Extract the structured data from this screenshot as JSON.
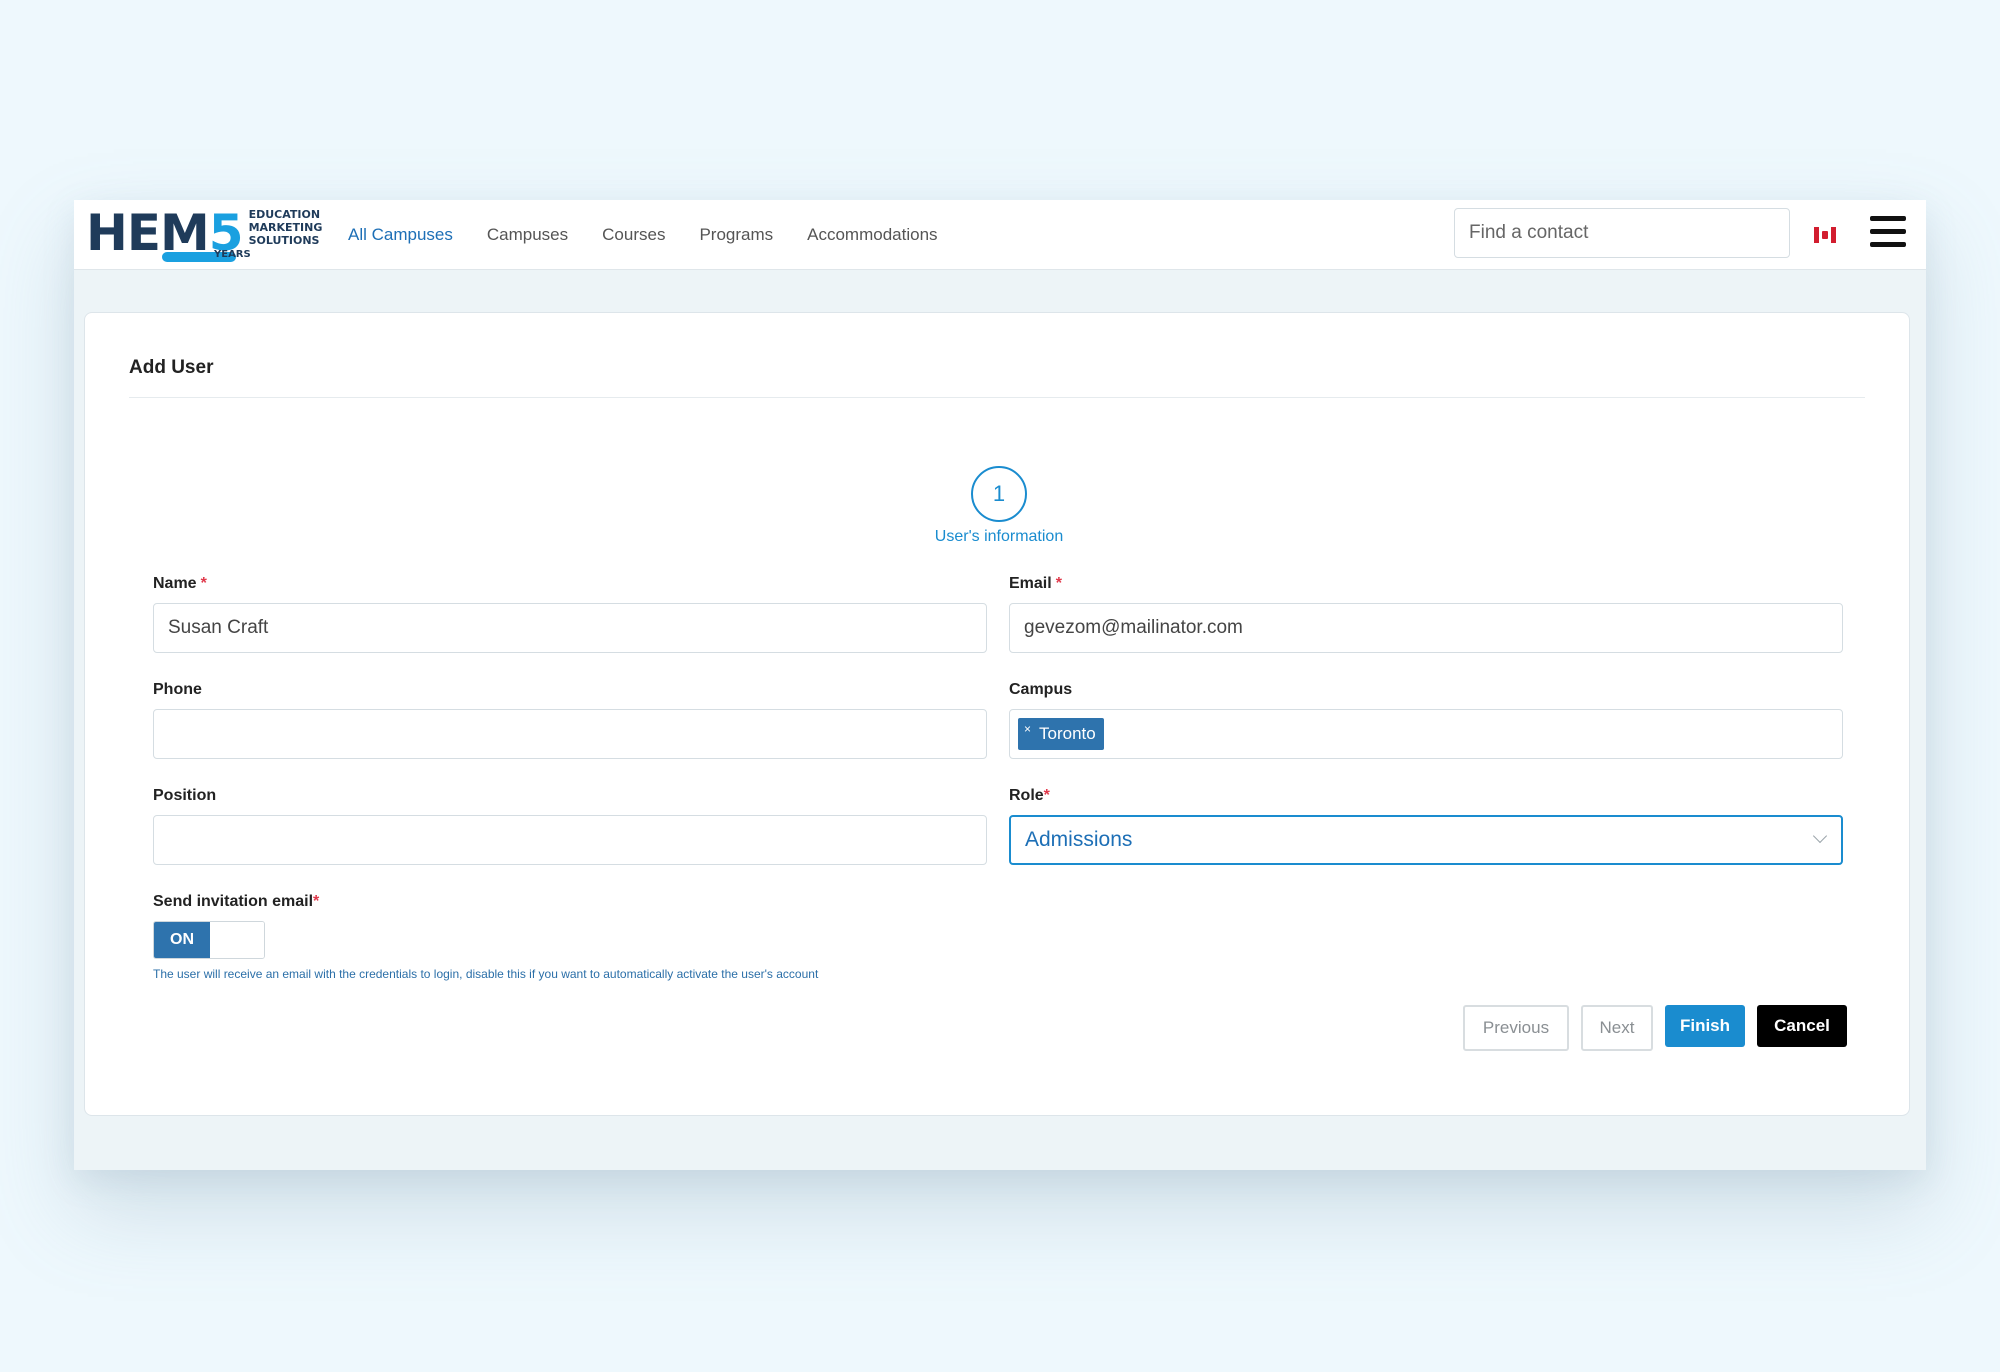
{
  "brand": {
    "logo_text_main": "HEM",
    "logo_text_5": "5",
    "logo_line1": "EDUCATION",
    "logo_line2": "MARKETING",
    "logo_line3": "SOLUTIONS",
    "logo_years": "YEARS"
  },
  "nav": {
    "items": [
      {
        "label": "All Campuses",
        "active": true
      },
      {
        "label": "Campuses",
        "active": false
      },
      {
        "label": "Courses",
        "active": false
      },
      {
        "label": "Programs",
        "active": false
      },
      {
        "label": "Accommodations",
        "active": false
      }
    ],
    "search_placeholder": "Find a contact",
    "flag_icon": "canada-flag-icon",
    "menu_icon": "hamburger-menu-icon"
  },
  "form": {
    "title": "Add User",
    "step_number": "1",
    "step_label": "User's information",
    "name_label": "Name",
    "name_value": "Susan Craft",
    "email_label": "Email",
    "email_value": "gevezom@mailinator.com",
    "phone_label": "Phone",
    "phone_value": "",
    "campus_label": "Campus",
    "campus_tag": "Toronto",
    "campus_tag_remove": "×",
    "position_label": "Position",
    "position_value": "",
    "role_label": "Role",
    "role_value": "Admissions",
    "required_mark": "*",
    "invite_label": "Send invitation email",
    "toggle_on": "ON",
    "help_text": "The user will receive an email with the credentials to login, disable this if you want to automatically activate the user's account",
    "btn_previous": "Previous",
    "btn_next": "Next",
    "btn_finish": "Finish",
    "btn_cancel": "Cancel"
  },
  "colors": {
    "accent": "#1a8ccf",
    "tag_bg": "#2e73ad",
    "required": "#e0394b"
  }
}
